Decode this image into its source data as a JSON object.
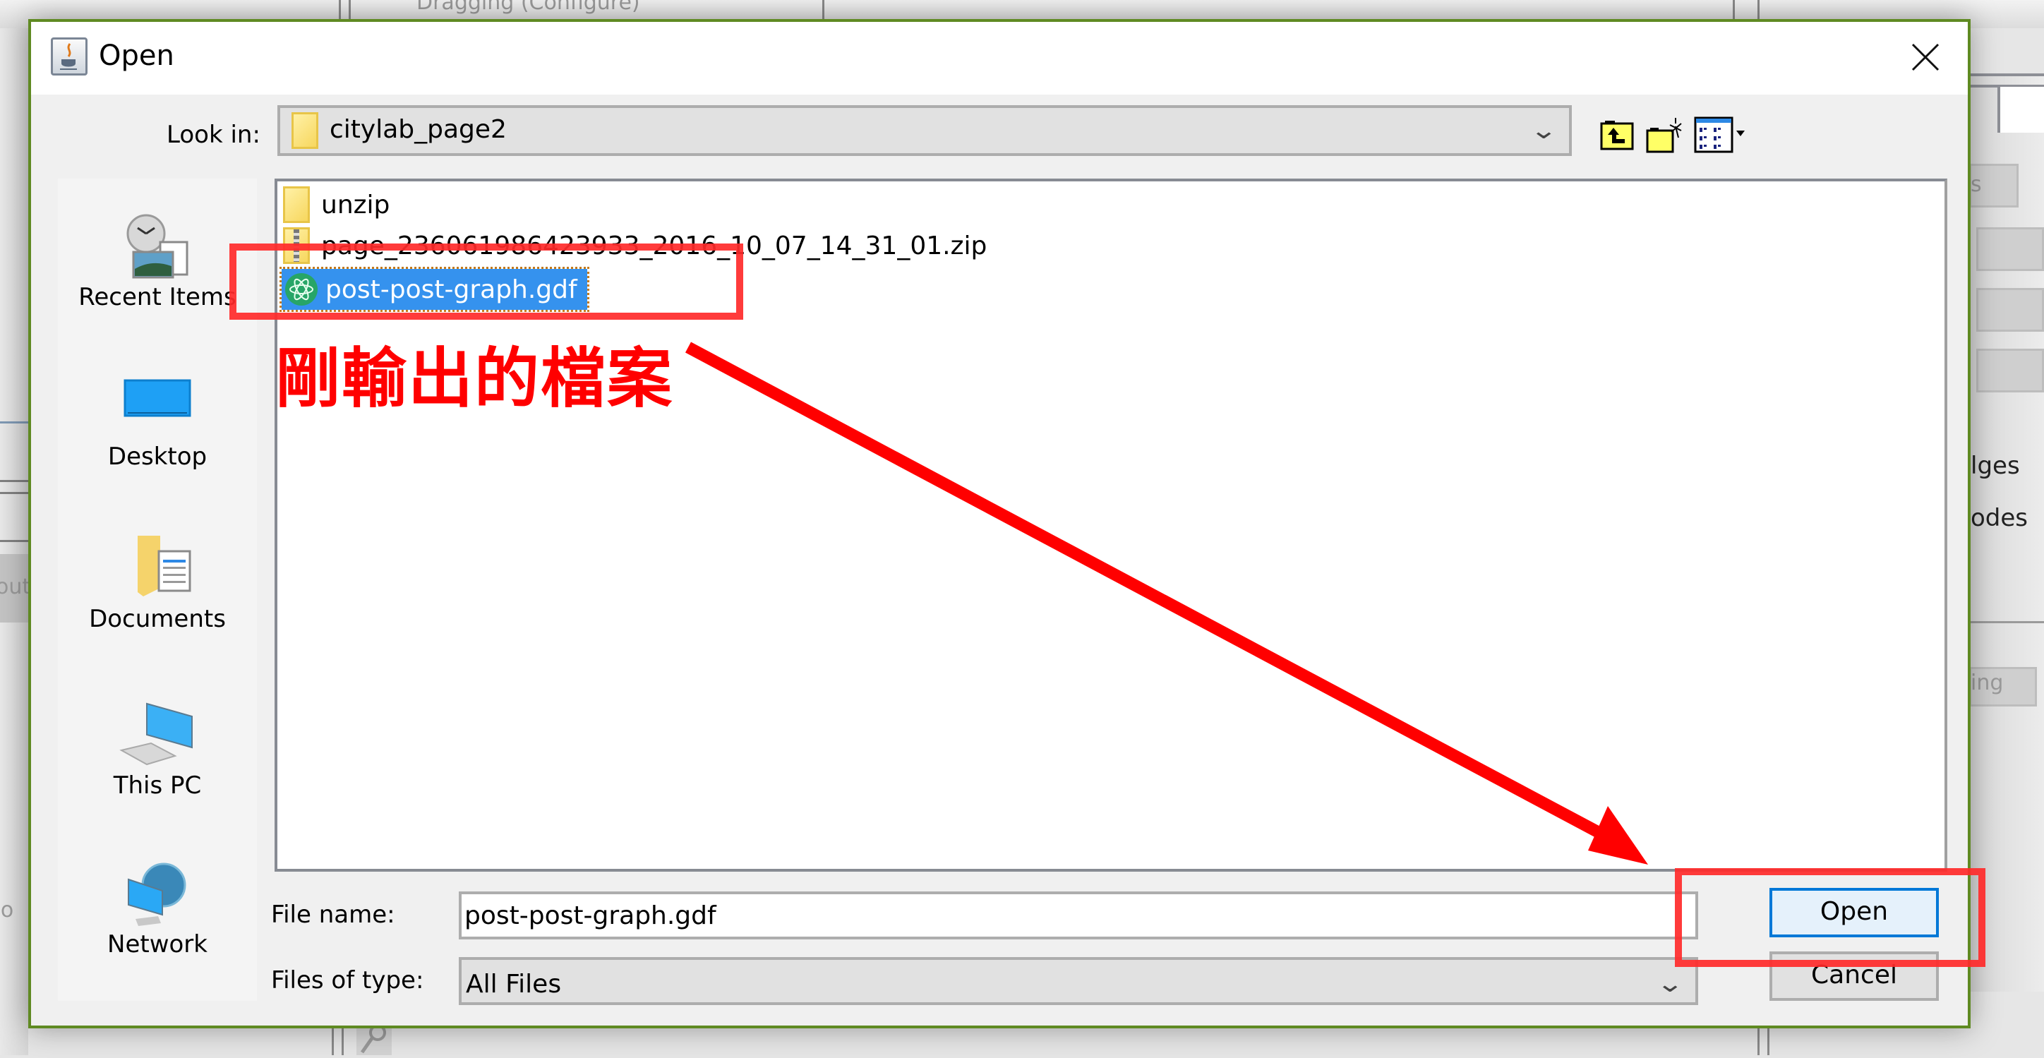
{
  "background": {
    "top_partial_text": "Dragging (Configure)",
    "right_partial_texts": [
      "s",
      "lges",
      "odes",
      "ing"
    ],
    "left_partial_texts": [
      "out",
      "Jo"
    ]
  },
  "dialog": {
    "title": "Open",
    "title_icon": "java-cup-icon",
    "close_label": "✕",
    "look_in": {
      "label": "Look in:",
      "value": "citylab_page2",
      "icon": "folder-icon"
    },
    "toolbar": [
      {
        "name": "up-one-level",
        "icon": "folder-up-icon"
      },
      {
        "name": "create-new-folder",
        "icon": "new-folder-icon"
      },
      {
        "name": "view-menu",
        "icon": "details-view-icon"
      }
    ],
    "sidebar": [
      {
        "label": "Recent Items",
        "icon": "recent-items-icon"
      },
      {
        "label": "Desktop",
        "icon": "desktop-icon"
      },
      {
        "label": "Documents",
        "icon": "documents-icon"
      },
      {
        "label": "This PC",
        "icon": "this-pc-icon"
      },
      {
        "label": "Network",
        "icon": "network-icon"
      }
    ],
    "files": [
      {
        "name": "unzip",
        "type": "folder",
        "selected": false
      },
      {
        "name": "page_236061986423933_2016_10_07_14_31_01.zip",
        "type": "zip",
        "selected": false
      },
      {
        "name": "post-post-graph.gdf",
        "type": "gdf",
        "selected": true
      }
    ],
    "file_name": {
      "label": "File name:",
      "value": "post-post-graph.gdf"
    },
    "files_of_type": {
      "label": "Files of type:",
      "value": "All Files"
    },
    "buttons": {
      "open": "Open",
      "cancel": "Cancel"
    }
  },
  "annotations": {
    "callout_text": "剛輸出的檔案",
    "color": "#ff0000"
  }
}
